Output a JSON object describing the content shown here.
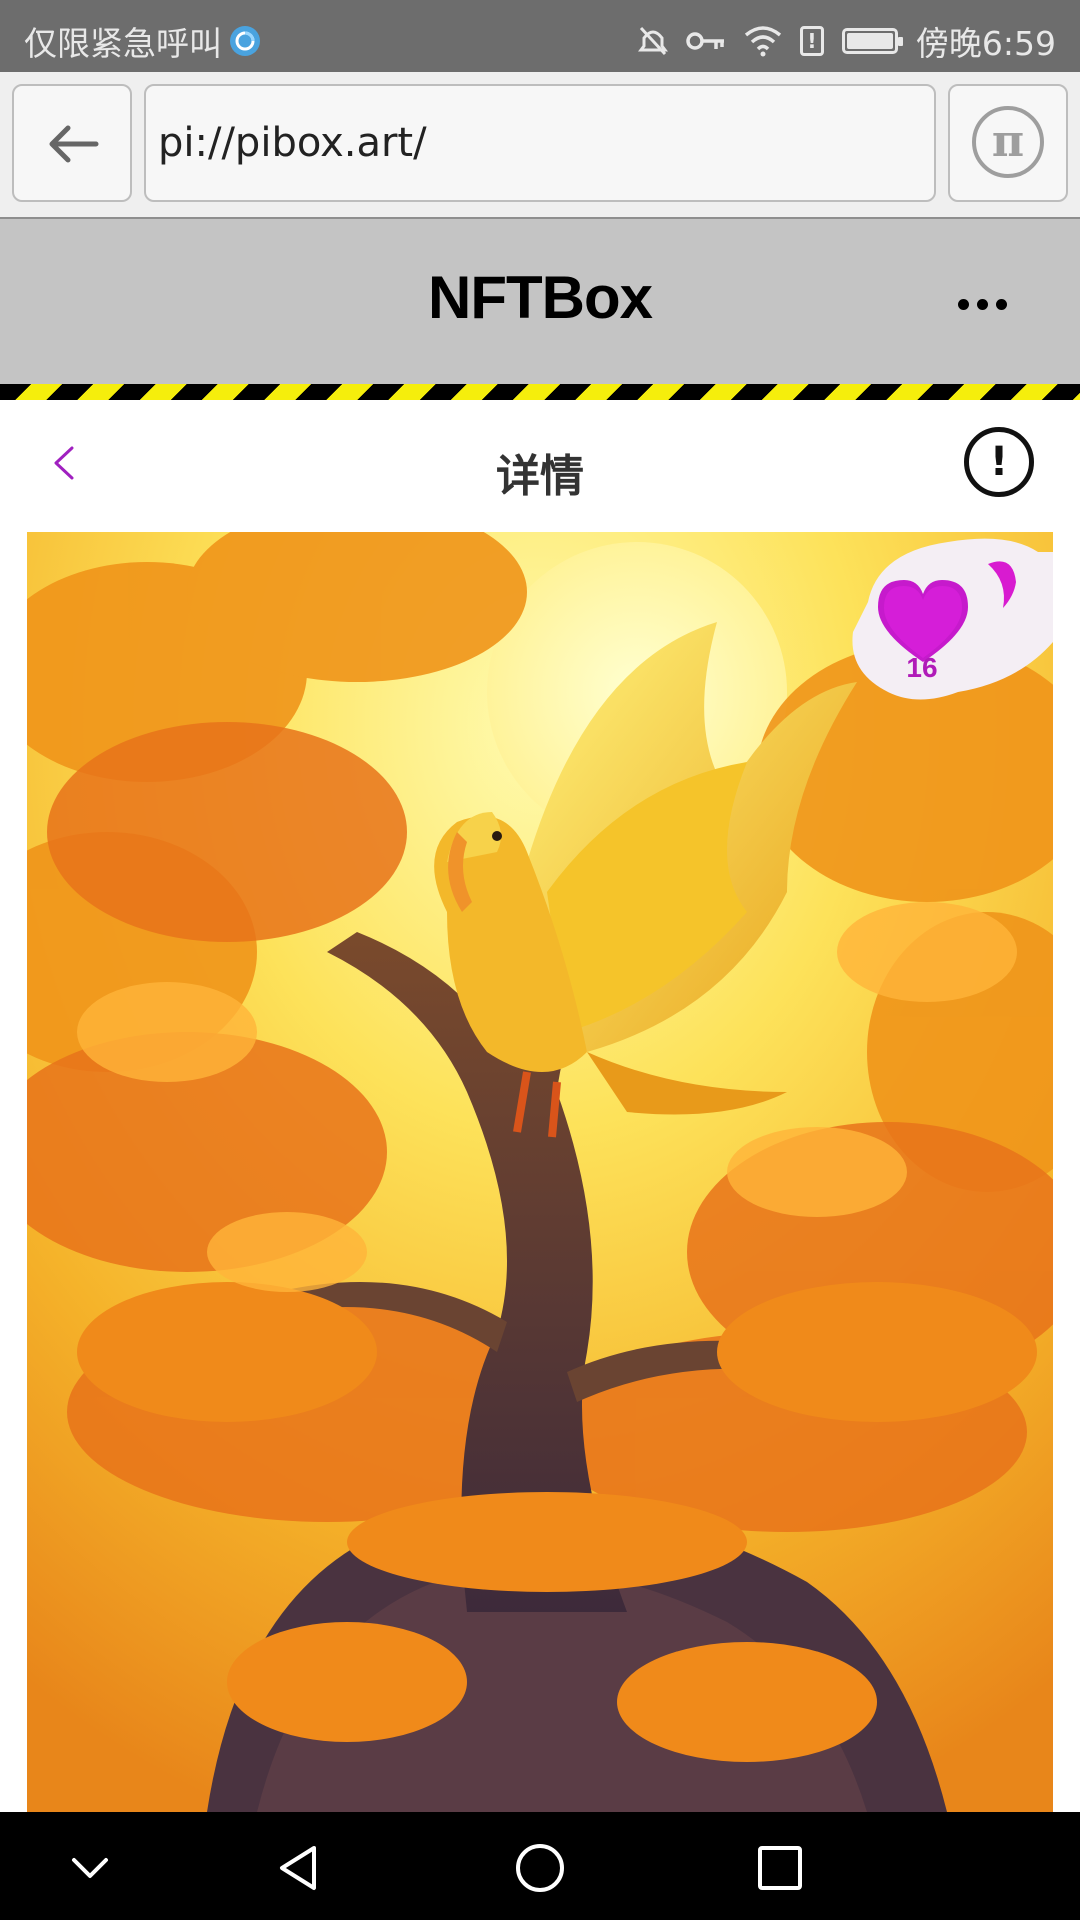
{
  "status_bar": {
    "carrier_text": "仅限紧急呼叫",
    "time_text": "傍晚6:59",
    "icons": [
      "hd-voice-icon",
      "mute-icon",
      "key-icon",
      "wifi-icon",
      "alert-icon",
      "battery-icon"
    ]
  },
  "browser": {
    "url": "pi://pibox.art/",
    "back_icon": "arrow-left-icon",
    "pi_icon": "pi-logo-icon",
    "pi_glyph": "π"
  },
  "header": {
    "title": "NFTBox",
    "menu_icon": "more-dots-icon"
  },
  "page": {
    "title": "详情",
    "back_icon": "chevron-left-icon",
    "info_glyph": "!"
  },
  "artwork": {
    "like_count": "16"
  },
  "nav": {
    "icons": [
      "hide-icon",
      "back-triangle-icon",
      "home-circle-icon",
      "recents-square-icon"
    ]
  },
  "colors": {
    "accent_purple": "#a020c0",
    "hazard_yellow": "#f5ee0c",
    "header_gray": "#c4c4c4"
  }
}
